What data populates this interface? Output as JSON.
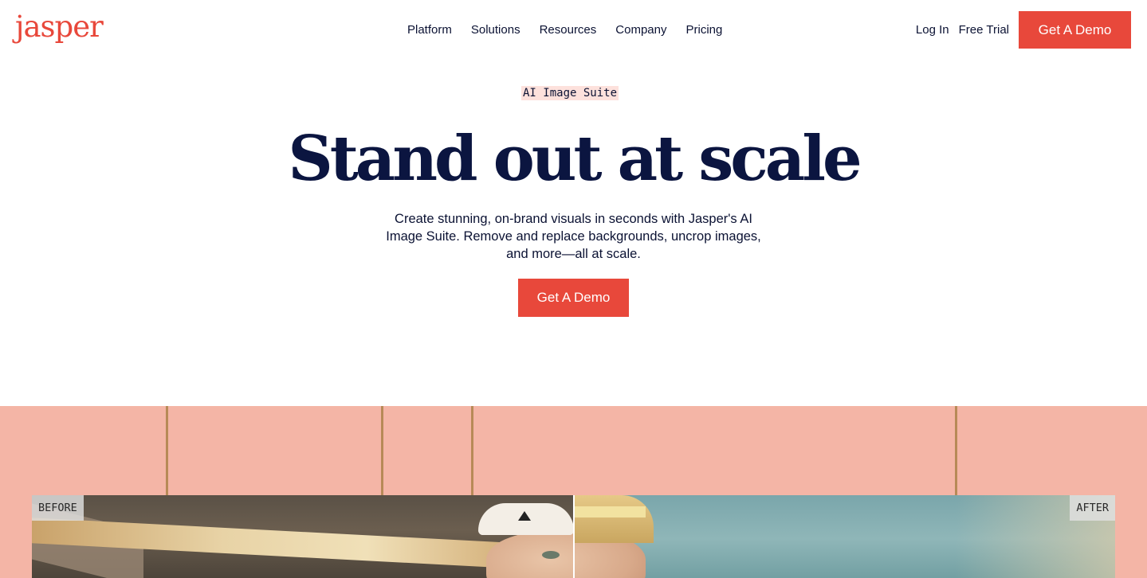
{
  "brand": {
    "logo_text": "jasper",
    "accent": "#e8483b",
    "navy": "#0b1540"
  },
  "nav": {
    "items": [
      {
        "label": "Platform"
      },
      {
        "label": "Solutions"
      },
      {
        "label": "Resources"
      },
      {
        "label": "Company"
      },
      {
        "label": "Pricing"
      }
    ],
    "login_label": "Log In",
    "trial_label": "Free Trial",
    "demo_label": "Get A Demo"
  },
  "hero": {
    "eyebrow": "AI Image Suite",
    "headline": "Stand out at scale",
    "subtext": "Create stunning, on-brand visuals in seconds with Jasper's AI Image Suite. Remove and replace backgrounds, uncrop images, and more—all at scale.",
    "cta_label": "Get A Demo"
  },
  "showcase": {
    "before_label": "BEFORE",
    "after_label": "AFTER",
    "background": "#f4b5a6"
  }
}
